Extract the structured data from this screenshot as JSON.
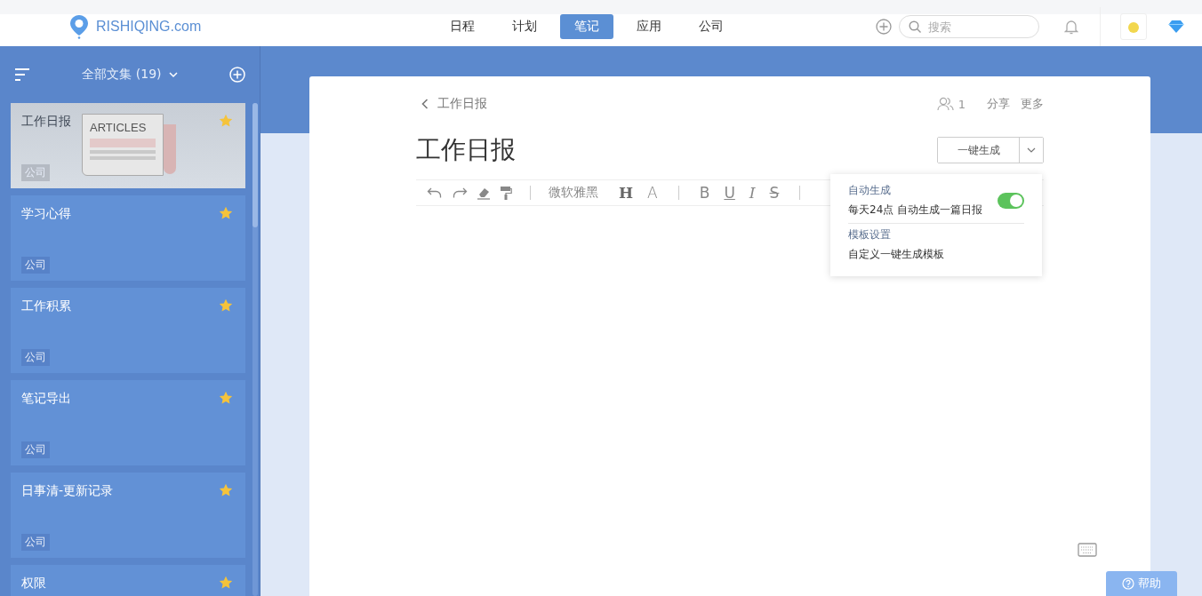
{
  "header": {
    "logo": "RISHIQING.com",
    "nav": [
      {
        "label": "日程",
        "selected": false
      },
      {
        "label": "计划",
        "selected": false
      },
      {
        "label": "笔记",
        "selected": true
      },
      {
        "label": "应用",
        "selected": false
      },
      {
        "label": "公司",
        "selected": false
      }
    ],
    "search": {
      "placeholder": "搜索"
    }
  },
  "sidebar": {
    "title": "全部文集 (19)",
    "notes": [
      {
        "title": "工作日报",
        "tag": "公司",
        "starred": true,
        "selected": true,
        "cover": "ARTICLES"
      },
      {
        "title": "学习心得",
        "tag": "公司",
        "starred": true,
        "selected": false
      },
      {
        "title": "工作积累",
        "tag": "公司",
        "starred": true,
        "selected": false
      },
      {
        "title": "笔记导出",
        "tag": "公司",
        "starred": true,
        "selected": false
      },
      {
        "title": "日事清-更新记录",
        "tag": "公司",
        "starred": true,
        "selected": false
      },
      {
        "title": "权限",
        "starred": true,
        "selected": false
      }
    ]
  },
  "document": {
    "breadcrumb": "工作日报",
    "members": "1",
    "actions": [
      "分享",
      "更多"
    ],
    "title": "工作日报",
    "generate_button": "一键生成",
    "toolbar": {
      "font": "微软雅黑",
      "marks": [
        "H",
        "A",
        "B",
        "U",
        "I",
        "S"
      ]
    },
    "menu": [
      {
        "kind": "toggle",
        "title": "自动生成",
        "description": "每天24点 自动生成一篇日报",
        "on": true
      },
      {
        "kind": "link",
        "title": "模板设置",
        "description": "自定义一键生成模板"
      }
    ]
  },
  "help_button": "帮助"
}
